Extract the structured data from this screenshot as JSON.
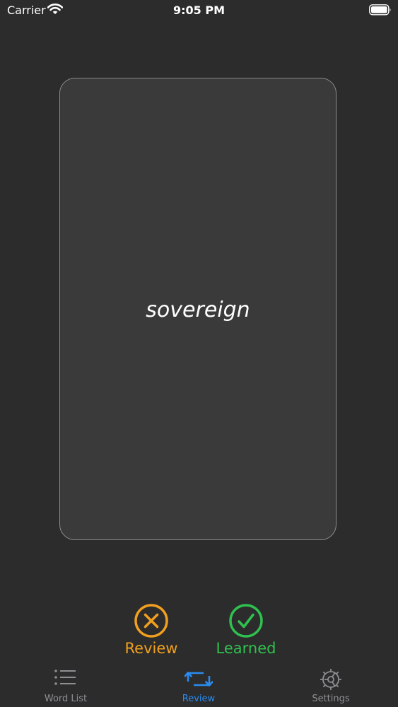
{
  "status_bar": {
    "carrier": "Carrier",
    "time": "9:05 PM"
  },
  "card": {
    "word": "sovereign"
  },
  "actions": {
    "review_label": "Review",
    "learned_label": "Learned"
  },
  "tabs": [
    {
      "label": "Word List",
      "icon": "list-icon"
    },
    {
      "label": "Review",
      "icon": "review-arrows-icon",
      "selected": true
    },
    {
      "label": "Settings",
      "icon": "gear-icon"
    }
  ],
  "colors": {
    "background": "#2c2c2c",
    "card": "#3a3a3a",
    "review_orange": "#f0a01e",
    "learned_green": "#2fc14f",
    "tab_selected_blue": "#2a8cf0",
    "tab_inactive_gray": "#8e8e93"
  }
}
